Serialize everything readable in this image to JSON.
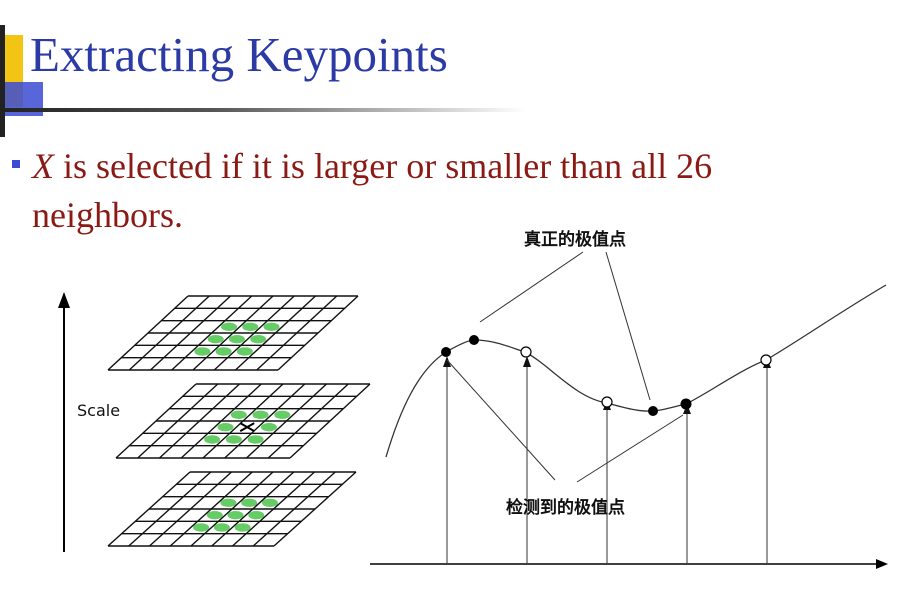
{
  "slide": {
    "title": "Extracting Keypoints",
    "bullet": {
      "variable": "X",
      "text": " is selected if it is larger or smaller than all 26 neighbors."
    }
  },
  "figure": {
    "scale_label": "Scale",
    "true_extrema_label": "真正的极值点",
    "detected_extrema_label": "检测到的极值点"
  }
}
